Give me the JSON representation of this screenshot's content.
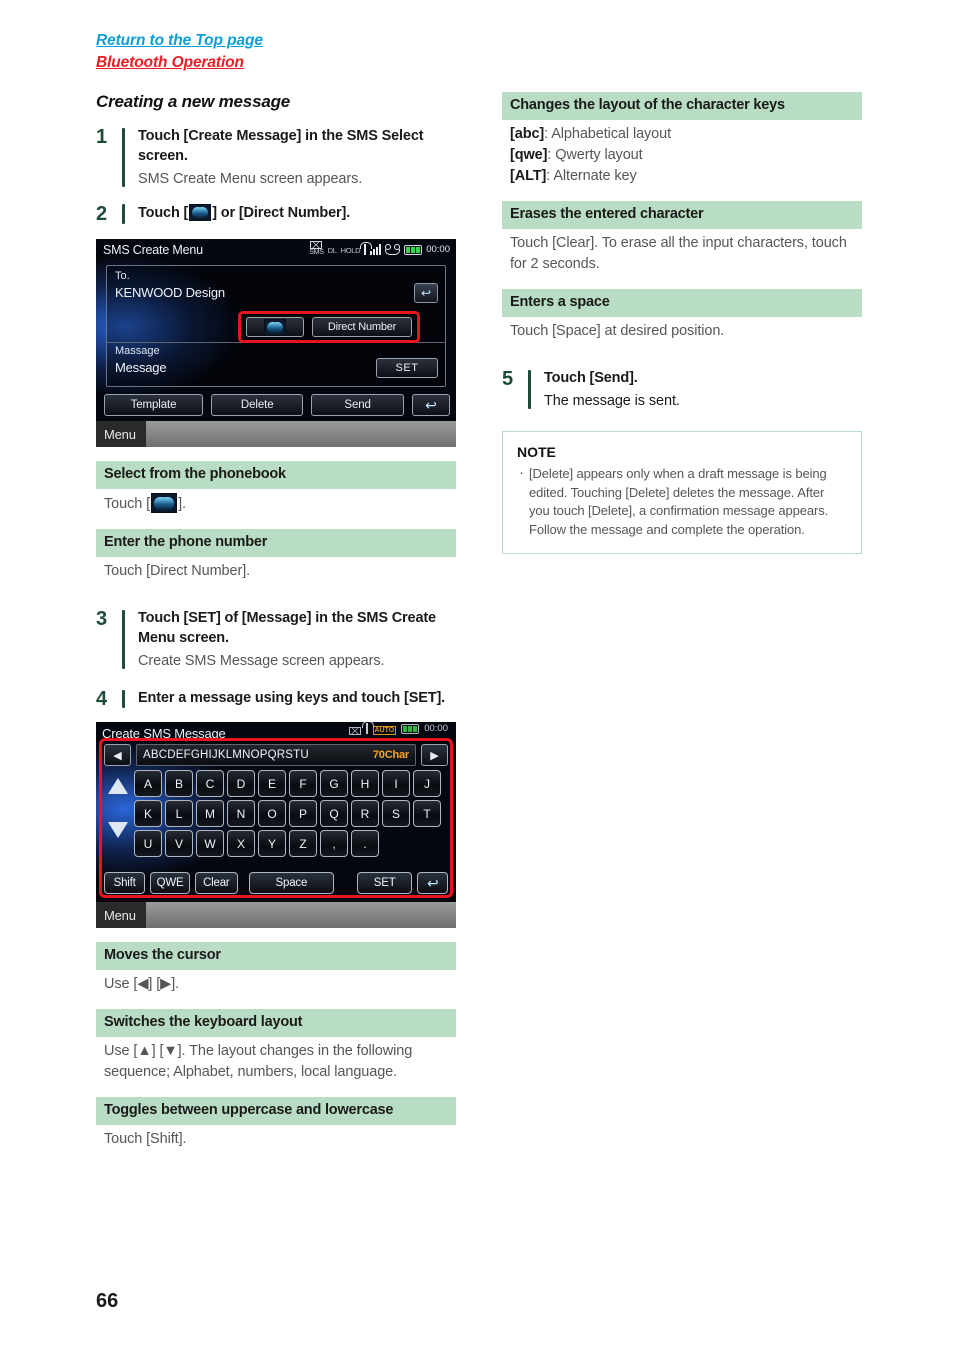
{
  "breadcrumb": {
    "top_link": "Return to the Top page",
    "sub_link": "Bluetooth Operation",
    "top_color": "#0c9fd6",
    "sub_color": "#ed1c24"
  },
  "page_number": "66",
  "left_column": {
    "section_title": "Creating a new message",
    "steps": [
      {
        "number": "1",
        "head": "Touch [Create Message] in the SMS Select screen.",
        "desc": "SMS Create Menu screen appears."
      },
      {
        "number": "2",
        "head_before": "Touch [",
        "head_after": "] or [Direct Number].",
        "icon": "phonebook-icon"
      },
      {
        "number": "3",
        "head": "Touch [SET] of [Message] in the SMS Create Menu screen.",
        "desc": "Create SMS Message screen appears."
      },
      {
        "number": "4",
        "head": "Enter a message using keys and touch [SET].",
        "desc": ""
      }
    ],
    "green_sections": [
      {
        "title": "Select from the phonebook",
        "body_before": "Touch [",
        "body_after": "].",
        "icon": "phonebook-icon"
      },
      {
        "title": "Enter the phone number",
        "body": "Touch [Direct Number]."
      },
      {
        "title": "Moves the cursor",
        "body": "Use [◀] [▶]."
      },
      {
        "title": "Switches the keyboard layout",
        "body": "Use [▲] [▼]. The layout changes in the following sequence; Alphabet, numbers, local language."
      },
      {
        "title": "Toggles between uppercase and lowercase",
        "body": "Touch [Shift]."
      }
    ]
  },
  "right_column": {
    "green_sections": [
      {
        "title": "Changes the layout of the character keys",
        "lines": [
          {
            "key": "[abc]",
            "text": ": Alphabetical layout"
          },
          {
            "key": "[qwe]",
            "text": ": Qwerty layout"
          },
          {
            "key": "[ALT]",
            "text": ": Alternate key"
          }
        ]
      },
      {
        "title": "Erases the entered character",
        "body": "Touch [Clear]. To erase all the input characters, touch for 2 seconds."
      },
      {
        "title": "Enters a space",
        "body": "Touch [Space] at desired position."
      }
    ],
    "step5": {
      "number": "5",
      "head": "Touch [Send].",
      "desc": "The message is sent."
    },
    "note": {
      "title": "NOTE",
      "items": [
        "[Delete] appears only when a draft message is being edited. Touching [Delete] deletes the message. After you touch [Delete], a confirmation message appears. Follow the message and complete the operation."
      ]
    }
  },
  "device_screen_1": {
    "title": "SMS Create Menu",
    "status": {
      "sms_label": "SMS",
      "dl_label": "DL",
      "hold_label": "HOLD",
      "time": "00:00"
    },
    "to_label": "To.",
    "to_value": "KENWOOD Design",
    "message_label": "Massage",
    "message_value": "Message",
    "set_button": "SET",
    "direct_number_button": "Direct Number",
    "phonebook_button": "phonebook-icon",
    "bottom_buttons": [
      "Template",
      "Delete",
      "Send"
    ],
    "back_button": "↩",
    "menu_tab": "Menu",
    "highlight_color": "#e8141e"
  },
  "device_screen_2": {
    "title": "Create SMS Message",
    "status": {
      "auto_label": "AUTO",
      "time": "00:00"
    },
    "entry_text": "ABCDEFGHIJKLMNOPQRSTU",
    "char_counter": "70Char",
    "arrow_left": "◀",
    "arrow_right": "▶",
    "key_rows": [
      [
        "A",
        "B",
        "C",
        "D",
        "E",
        "F",
        "G",
        "H",
        "I",
        "J"
      ],
      [
        "K",
        "L",
        "M",
        "N",
        "O",
        "P",
        "Q",
        "R",
        "S",
        "T"
      ],
      [
        "U",
        "V",
        "W",
        "X",
        "Y",
        "Z",
        ",",
        "."
      ]
    ],
    "bottom_buttons": {
      "shift": "Shift",
      "qwe": "QWE",
      "clear": "Clear",
      "space": "Space",
      "set": "SET",
      "back": "↩"
    },
    "menu_tab": "Menu",
    "highlight_color": "#e8141e"
  }
}
